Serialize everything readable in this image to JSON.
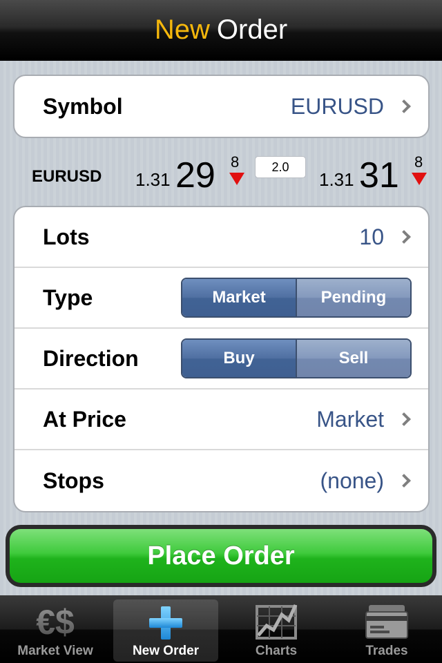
{
  "navbar": {
    "title_accent": "New",
    "title_main": "Order"
  },
  "symbol_group": {
    "label": "Symbol",
    "value": "EURUSD"
  },
  "quote": {
    "symbol": "EURUSD",
    "bid": {
      "prefix": "1.31",
      "big": "29",
      "pip": "8",
      "direction": "down"
    },
    "spread": "2.0",
    "ask": {
      "prefix": "1.31",
      "big": "31",
      "pip": "8",
      "direction": "down"
    }
  },
  "order_group": {
    "lots": {
      "label": "Lots",
      "value": "10"
    },
    "type": {
      "label": "Type",
      "options": [
        "Market",
        "Pending"
      ],
      "selected": "Market"
    },
    "direction": {
      "label": "Direction",
      "options": [
        "Buy",
        "Sell"
      ],
      "selected": "Buy"
    },
    "at_price": {
      "label": "At Price",
      "value": "Market"
    },
    "stops": {
      "label": "Stops",
      "value": "(none)"
    }
  },
  "place_order": {
    "label": "Place Order"
  },
  "tabbar": {
    "tabs": [
      {
        "label": "Market View",
        "icon": "currency-icon"
      },
      {
        "label": "New Order",
        "icon": "plus-icon",
        "active": true
      },
      {
        "label": "Charts",
        "icon": "chart-icon"
      },
      {
        "label": "Trades",
        "icon": "trades-icon"
      }
    ]
  },
  "colors": {
    "accent": "#f6b80c",
    "value_blue": "#385487",
    "down_red": "#e11010",
    "button_green": "#1fb31c"
  }
}
